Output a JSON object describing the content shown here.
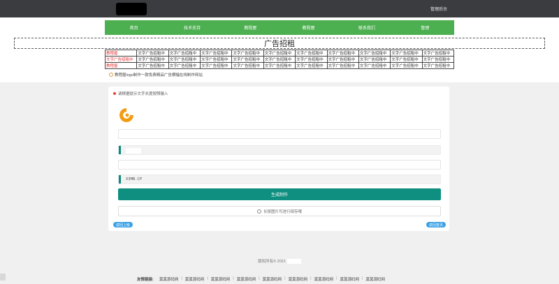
{
  "header": {
    "admin_link": "管理后台"
  },
  "nav": [
    "首页",
    "技术支持",
    "教程屋",
    "教程屋",
    "联系我们",
    "管理"
  ],
  "ad_banner": {
    "title": "广告招租"
  },
  "ad_table": {
    "rows": [
      [
        "教程屋",
        "文字广告招租中",
        "文字广告招租中",
        "文字广告招租中",
        "文字广告招租中",
        "文字广告招租中",
        "文字广告招租中",
        "文字广告招租中",
        "文字广告招租中",
        "文字广告招租中",
        "文字广告招租中"
      ],
      [
        "文字广告招租中",
        "文字广告招租中",
        "文字广告招租中",
        "文字广告招租中",
        "文字广告招租中",
        "文字广告招租中",
        "文字广告招租中",
        "文字广告招租中",
        "文字广告招租中",
        "文字广告招租中",
        "文字广告招租中"
      ],
      [
        "教程屋",
        "文字广告招租中",
        "文字广告招租中",
        "文字广告招租中",
        "文字广告招租中",
        "文字广告招租中",
        "文字广告招租中",
        "文字广告招租中",
        "文字广告招租中",
        "文字广告招租中",
        "文字广告招租中"
      ]
    ]
  },
  "promo": {
    "text": "教程屋logo制作一款免费精品广告横幅在线制作网站"
  },
  "form": {
    "hint": "请根据提示文字长度按照输入",
    "field_value": "X3MB.CP",
    "generate_label": "生成制作",
    "save_label": "长按图片可进行保存哦",
    "back_label": "返回上级",
    "home_label": "返回首页"
  },
  "footer": {
    "copyright": "版权所有© 2021",
    "friends_label": "友情链接:",
    "links": [
      "莫莫源码网",
      "莫莫源码网",
      "莫莫源码网",
      "莫莫源码网",
      "莫莫源码网",
      "莫莫源码网",
      "莫莫源码网",
      "莫莫源码网",
      "莫莫源码网"
    ]
  },
  "colors": {
    "nav_green": "#4caf50",
    "primary_teal": "#0e8f80",
    "pill_blue": "#3ba0e5",
    "red": "#e03030"
  }
}
